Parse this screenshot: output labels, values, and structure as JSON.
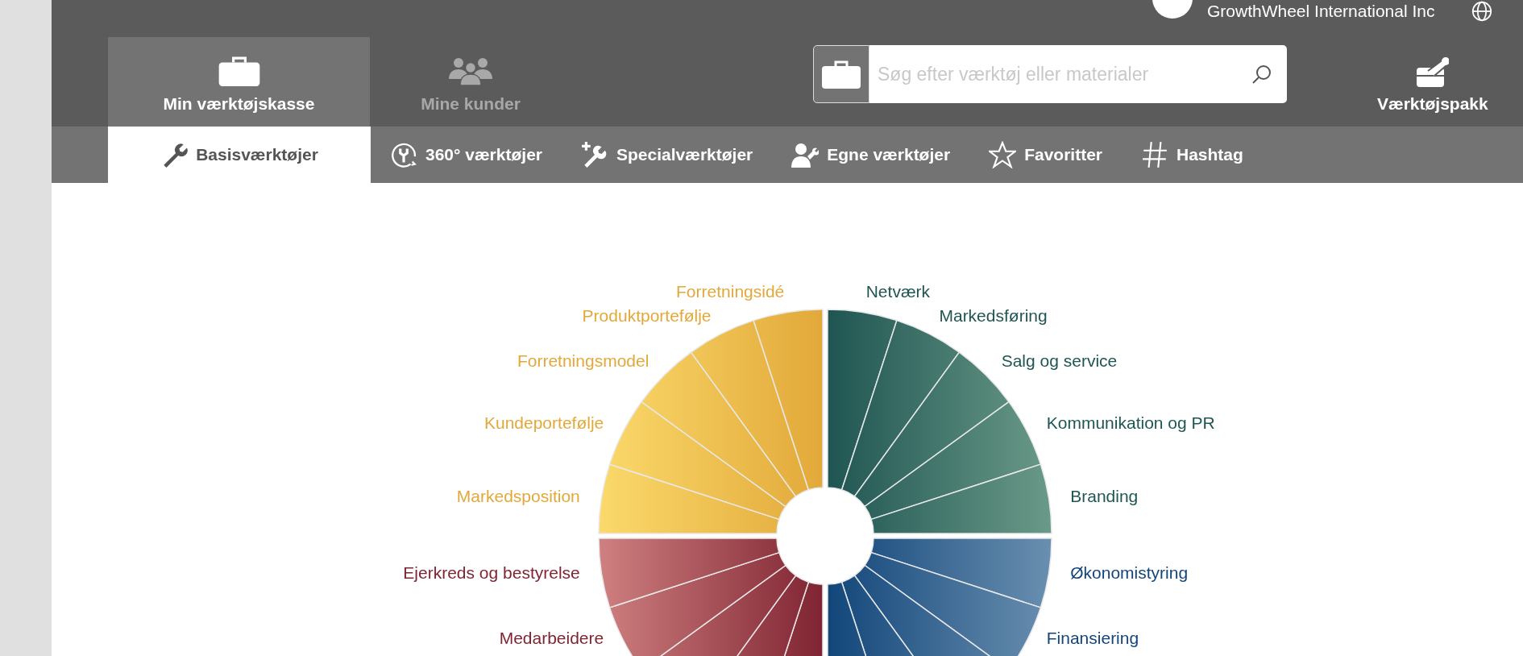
{
  "user": {
    "name": "GrowthWheel International Inc"
  },
  "main_tabs": [
    {
      "label": "Min værktøjskasse",
      "kind": "briefcase",
      "selected": true
    },
    {
      "label": "Mine kunder",
      "kind": "people",
      "selected": false
    }
  ],
  "search": {
    "placeholder": "Søg efter værktøj eller materialer"
  },
  "toolkit_button": {
    "label": "Værktøjspakk"
  },
  "sub_tabs": [
    {
      "label": "Basisværktøjer",
      "kind": "wrench",
      "selected": true
    },
    {
      "label": "360° værktøjer",
      "kind": "cycle",
      "selected": false
    },
    {
      "label": "Specialværktøjer",
      "kind": "special",
      "selected": false
    },
    {
      "label": "Egne værktøjer",
      "kind": "own",
      "selected": false
    },
    {
      "label": "Favoritter",
      "kind": "star",
      "selected": false
    },
    {
      "label": "Hashtag",
      "kind": "hash",
      "selected": false
    }
  ],
  "wheel": {
    "quadrants": [
      {
        "kind": "top-left",
        "color": "#e2a93a",
        "items": [
          "Forretningsidé",
          "Produktportefølje",
          "Forretningsmodel",
          "Kundeportefølje",
          "Markedsposition"
        ]
      },
      {
        "kind": "top-right",
        "color": "#1f5552",
        "items": [
          "Netværk",
          "Markedsføring",
          "Salg og service",
          "Kommunikation og PR",
          "Branding"
        ]
      },
      {
        "kind": "bottom-left",
        "color": "#7f2432",
        "items": [
          "Ejerkreds og bestyrelse",
          "Medarbeidere"
        ]
      },
      {
        "kind": "bottom-right",
        "color": "#12467a",
        "items": [
          "Økonomistyring",
          "Finansiering"
        ]
      }
    ]
  }
}
